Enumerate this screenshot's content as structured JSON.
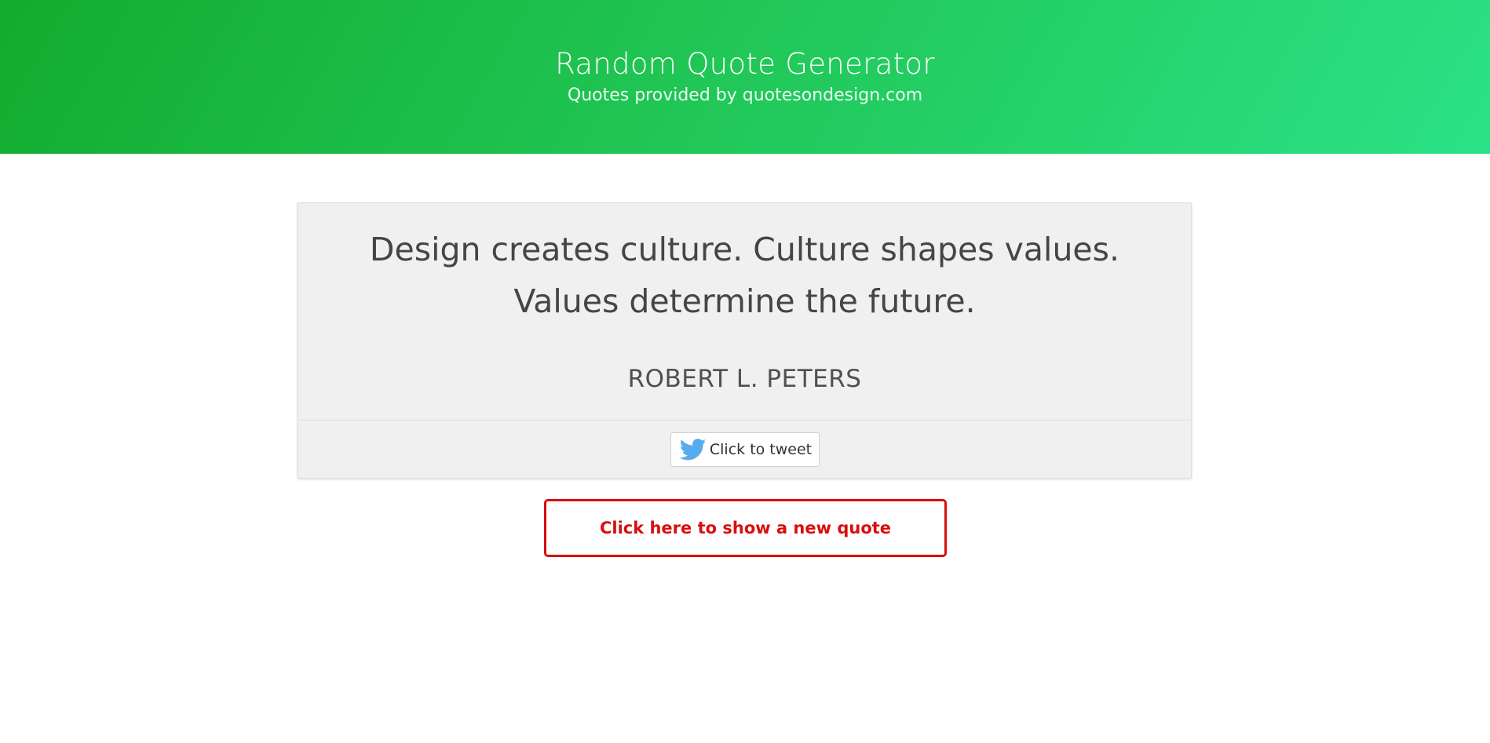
{
  "header": {
    "title": "Random Quote Generator",
    "subtitle": "Quotes provided by quotesondesign.com"
  },
  "quote": {
    "text": "Design creates culture. Culture shapes values. Values determine the future.",
    "author": "ROBERT L. PETERS"
  },
  "tweet": {
    "label": "Click to tweet",
    "icon": "twitter-bird-icon"
  },
  "new_quote": {
    "label": "Click here to show a new quote"
  },
  "colors": {
    "header_gradient_start": "#12ac2f",
    "header_gradient_end": "#2be287",
    "card_background": "#f0f0f0",
    "quote_text": "#454545",
    "button_accent": "#d90e0e",
    "twitter_blue": "#55acee"
  }
}
